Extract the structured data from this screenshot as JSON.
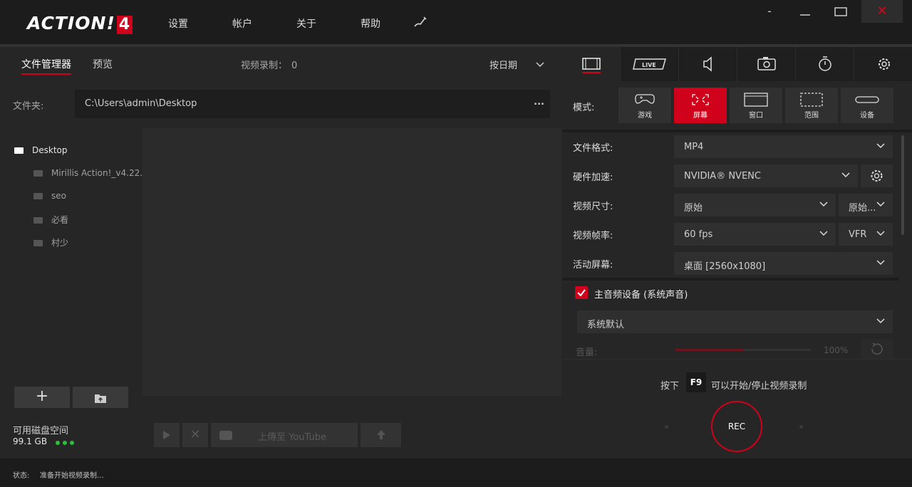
{
  "app": {
    "logo_text": "ACTION!",
    "logo_version": "4"
  },
  "menu": {
    "settings": "设置",
    "account": "帐户",
    "about": "关于",
    "help": "帮助"
  },
  "window": {
    "minimize": "-",
    "close": "✕"
  },
  "left": {
    "tabs": {
      "file_manager": "文件管理器",
      "preview": "预览"
    },
    "video_count_label": "视频录制：",
    "video_count": "0",
    "sort_label": "按日期",
    "folder_label": "文件夹:",
    "folder_path": "C:\\Users\\admin\\Desktop",
    "folder_more": "...",
    "tree": [
      {
        "label": "Desktop"
      },
      {
        "label": "Mirillis Action!_v4.22...."
      },
      {
        "label": "seo"
      },
      {
        "label": "必看"
      },
      {
        "label": "村少"
      }
    ],
    "disk_label": "可用磁盘空间",
    "disk_value": "99.1 GB",
    "upload_label": "上傳至 YouTube"
  },
  "right": {
    "mode_label": "模式:",
    "modes": [
      {
        "label": "游戏"
      },
      {
        "label": "屏幕"
      },
      {
        "label": "窗口"
      },
      {
        "label": "范围"
      },
      {
        "label": "设备"
      }
    ],
    "live_label": "LIVE",
    "settings": {
      "format_label": "文件格式:",
      "format_value": "MP4",
      "hw_label": "硬件加速:",
      "hw_value": "NVIDIA® NVENC",
      "size_label": "视频尺寸:",
      "size_value": "原始",
      "size_value2": "原始...",
      "fps_label": "视频帧率:",
      "fps_value": "60 fps",
      "fps_mode": "VFR",
      "screen_label": "活动屏幕:",
      "screen_value": "桌面 [2560x1080]"
    },
    "audio": {
      "main_device_label": "主音频设备 (系统声音)",
      "device_value": "系统默认",
      "volume_label": "音量:",
      "volume_percent": "100%",
      "volume_level": 0.5
    },
    "hint_prefix": "按下",
    "hint_key": "F9",
    "hint_suffix": "可以开始/停止视频录制",
    "rec_label": "REC"
  },
  "status": {
    "label": "状态:",
    "text": "准备开始视频录制..."
  },
  "colors": {
    "accent": "#d0021b",
    "disk_dots": "#2bbf3a"
  }
}
